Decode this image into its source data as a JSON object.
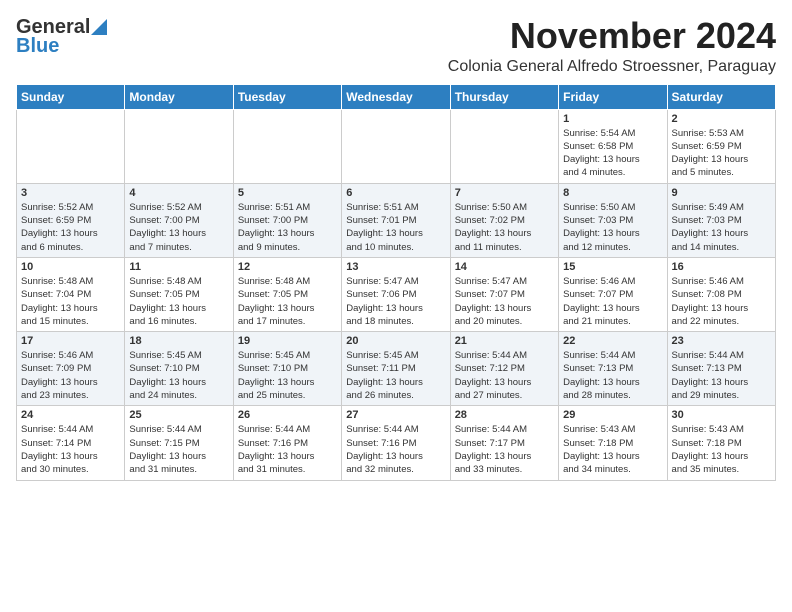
{
  "header": {
    "logo_general": "General",
    "logo_blue": "Blue",
    "month_title": "November 2024",
    "location": "Colonia General Alfredo Stroessner, Paraguay"
  },
  "days_of_week": [
    "Sunday",
    "Monday",
    "Tuesday",
    "Wednesday",
    "Thursday",
    "Friday",
    "Saturday"
  ],
  "weeks": [
    [
      {
        "day": "",
        "info": ""
      },
      {
        "day": "",
        "info": ""
      },
      {
        "day": "",
        "info": ""
      },
      {
        "day": "",
        "info": ""
      },
      {
        "day": "",
        "info": ""
      },
      {
        "day": "1",
        "info": "Sunrise: 5:54 AM\nSunset: 6:58 PM\nDaylight: 13 hours\nand 4 minutes."
      },
      {
        "day": "2",
        "info": "Sunrise: 5:53 AM\nSunset: 6:59 PM\nDaylight: 13 hours\nand 5 minutes."
      }
    ],
    [
      {
        "day": "3",
        "info": "Sunrise: 5:52 AM\nSunset: 6:59 PM\nDaylight: 13 hours\nand 6 minutes."
      },
      {
        "day": "4",
        "info": "Sunrise: 5:52 AM\nSunset: 7:00 PM\nDaylight: 13 hours\nand 7 minutes."
      },
      {
        "day": "5",
        "info": "Sunrise: 5:51 AM\nSunset: 7:00 PM\nDaylight: 13 hours\nand 9 minutes."
      },
      {
        "day": "6",
        "info": "Sunrise: 5:51 AM\nSunset: 7:01 PM\nDaylight: 13 hours\nand 10 minutes."
      },
      {
        "day": "7",
        "info": "Sunrise: 5:50 AM\nSunset: 7:02 PM\nDaylight: 13 hours\nand 11 minutes."
      },
      {
        "day": "8",
        "info": "Sunrise: 5:50 AM\nSunset: 7:03 PM\nDaylight: 13 hours\nand 12 minutes."
      },
      {
        "day": "9",
        "info": "Sunrise: 5:49 AM\nSunset: 7:03 PM\nDaylight: 13 hours\nand 14 minutes."
      }
    ],
    [
      {
        "day": "10",
        "info": "Sunrise: 5:48 AM\nSunset: 7:04 PM\nDaylight: 13 hours\nand 15 minutes."
      },
      {
        "day": "11",
        "info": "Sunrise: 5:48 AM\nSunset: 7:05 PM\nDaylight: 13 hours\nand 16 minutes."
      },
      {
        "day": "12",
        "info": "Sunrise: 5:48 AM\nSunset: 7:05 PM\nDaylight: 13 hours\nand 17 minutes."
      },
      {
        "day": "13",
        "info": "Sunrise: 5:47 AM\nSunset: 7:06 PM\nDaylight: 13 hours\nand 18 minutes."
      },
      {
        "day": "14",
        "info": "Sunrise: 5:47 AM\nSunset: 7:07 PM\nDaylight: 13 hours\nand 20 minutes."
      },
      {
        "day": "15",
        "info": "Sunrise: 5:46 AM\nSunset: 7:07 PM\nDaylight: 13 hours\nand 21 minutes."
      },
      {
        "day": "16",
        "info": "Sunrise: 5:46 AM\nSunset: 7:08 PM\nDaylight: 13 hours\nand 22 minutes."
      }
    ],
    [
      {
        "day": "17",
        "info": "Sunrise: 5:46 AM\nSunset: 7:09 PM\nDaylight: 13 hours\nand 23 minutes."
      },
      {
        "day": "18",
        "info": "Sunrise: 5:45 AM\nSunset: 7:10 PM\nDaylight: 13 hours\nand 24 minutes."
      },
      {
        "day": "19",
        "info": "Sunrise: 5:45 AM\nSunset: 7:10 PM\nDaylight: 13 hours\nand 25 minutes."
      },
      {
        "day": "20",
        "info": "Sunrise: 5:45 AM\nSunset: 7:11 PM\nDaylight: 13 hours\nand 26 minutes."
      },
      {
        "day": "21",
        "info": "Sunrise: 5:44 AM\nSunset: 7:12 PM\nDaylight: 13 hours\nand 27 minutes."
      },
      {
        "day": "22",
        "info": "Sunrise: 5:44 AM\nSunset: 7:13 PM\nDaylight: 13 hours\nand 28 minutes."
      },
      {
        "day": "23",
        "info": "Sunrise: 5:44 AM\nSunset: 7:13 PM\nDaylight: 13 hours\nand 29 minutes."
      }
    ],
    [
      {
        "day": "24",
        "info": "Sunrise: 5:44 AM\nSunset: 7:14 PM\nDaylight: 13 hours\nand 30 minutes."
      },
      {
        "day": "25",
        "info": "Sunrise: 5:44 AM\nSunset: 7:15 PM\nDaylight: 13 hours\nand 31 minutes."
      },
      {
        "day": "26",
        "info": "Sunrise: 5:44 AM\nSunset: 7:16 PM\nDaylight: 13 hours\nand 31 minutes."
      },
      {
        "day": "27",
        "info": "Sunrise: 5:44 AM\nSunset: 7:16 PM\nDaylight: 13 hours\nand 32 minutes."
      },
      {
        "day": "28",
        "info": "Sunrise: 5:44 AM\nSunset: 7:17 PM\nDaylight: 13 hours\nand 33 minutes."
      },
      {
        "day": "29",
        "info": "Sunrise: 5:43 AM\nSunset: 7:18 PM\nDaylight: 13 hours\nand 34 minutes."
      },
      {
        "day": "30",
        "info": "Sunrise: 5:43 AM\nSunset: 7:18 PM\nDaylight: 13 hours\nand 35 minutes."
      }
    ]
  ]
}
